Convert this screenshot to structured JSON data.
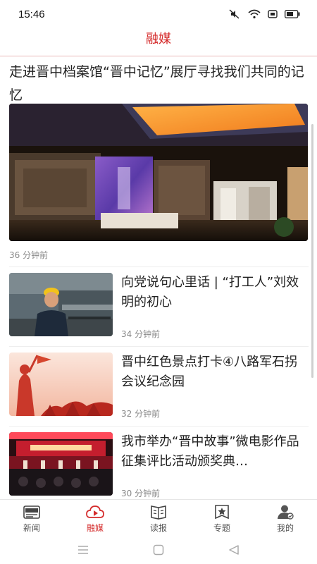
{
  "status_bar": {
    "time": "15:46"
  },
  "header": {
    "title": "融媒"
  },
  "feature": {
    "title": "走进晋中档案馆“晋中记忆”展厅寻找我们共同的记忆",
    "time": "36 分钟前"
  },
  "articles": [
    {
      "title": "向党说句心里话 | “打工人”刘效明的初心",
      "time": "34 分钟前"
    },
    {
      "title": "晋中红色景点打卡④八路军石拐会议纪念园",
      "time": "32 分钟前"
    },
    {
      "title": "我市举办“晋中故事”微电影作品征集评比活动颁奖典…",
      "time": "30 分钟前"
    }
  ],
  "tabs": [
    {
      "label": "新闻",
      "icon": "news-icon"
    },
    {
      "label": "融媒",
      "icon": "media-icon",
      "active": true
    },
    {
      "label": "读报",
      "icon": "newspaper-icon"
    },
    {
      "label": "专题",
      "icon": "topic-icon"
    },
    {
      "label": "我的",
      "icon": "profile-icon"
    }
  ],
  "colors": {
    "accent": "#d42a2a",
    "text": "#222222",
    "muted": "#888888"
  }
}
